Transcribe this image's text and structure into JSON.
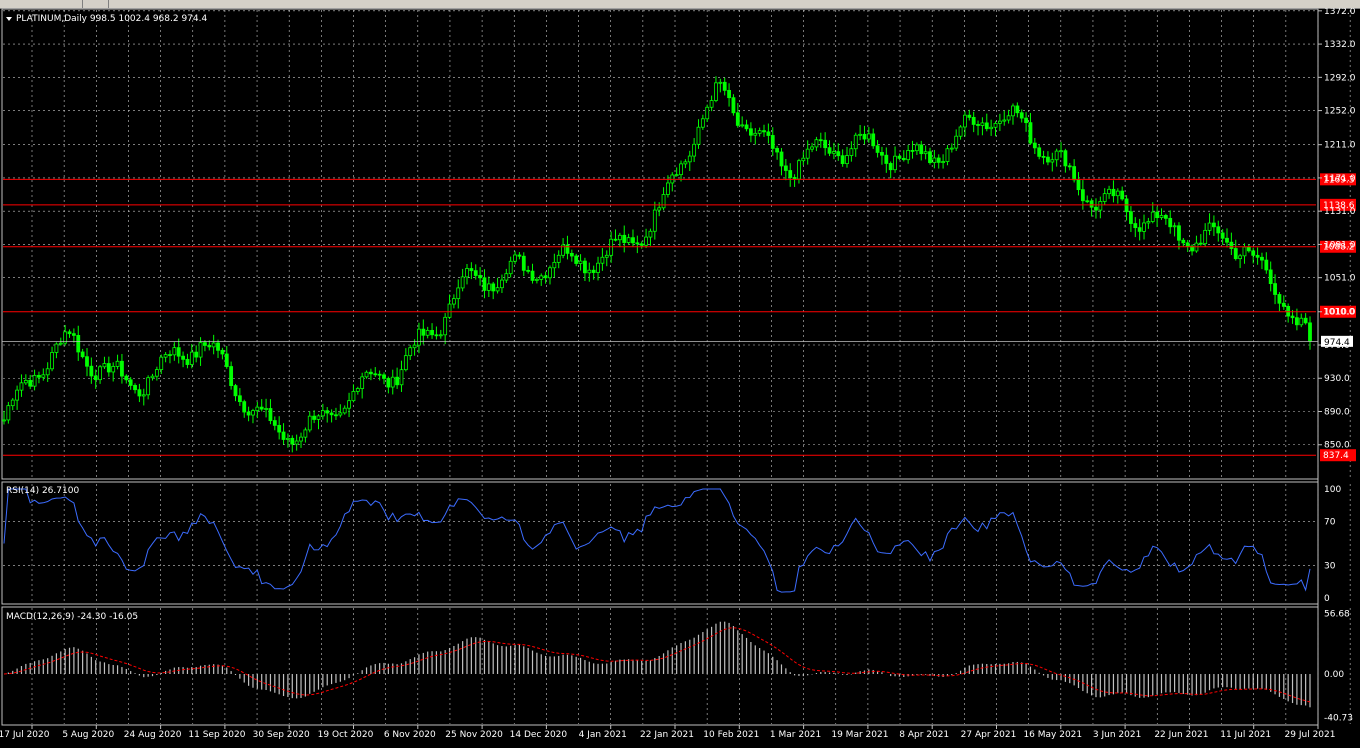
{
  "main_pane": {
    "symbol": "PLATINUM",
    "timeframe": "Daily",
    "ohlc": "998.5 1002.4 968.2 974.4",
    "title": "PLATINUM,Daily  998.5 1002.4 968.2 974.4",
    "current_price": "974.4",
    "y_ticks": [
      "1372.0",
      "1332.0",
      "1292.0",
      "1252.0",
      "1211.0",
      "1171.0",
      "1131.0",
      "1091.0",
      "1051.0",
      "1010.0",
      "970.0",
      "930.0",
      "890.0",
      "850.0"
    ],
    "y_range": [
      810,
      1373
    ]
  },
  "levels": [
    {
      "value": 1169.3,
      "label": "1169.3"
    },
    {
      "value": 1138.6,
      "label": "1138.6"
    },
    {
      "value": 1088.2,
      "label": "1088.2"
    },
    {
      "value": 1010.0,
      "label": "1010.0"
    },
    {
      "value": 837.4,
      "label": "837.4"
    }
  ],
  "rsi_pane": {
    "title": "RSI(14) 26.7100",
    "y_ticks": [
      "100",
      "70",
      "30",
      "0"
    ],
    "current": 26.71
  },
  "macd_pane": {
    "title": "MACD(12,26,9) -24.30 -16.05",
    "y_ticks": [
      "56.68",
      "0.00",
      "-40.73"
    ],
    "range": [
      -45,
      60
    ]
  },
  "x_axis": {
    "dates": [
      "17 Jul 2020",
      "5 Aug 2020",
      "24 Aug 2020",
      "11 Sep 2020",
      "30 Sep 2020",
      "19 Oct 2020",
      "6 Nov 2020",
      "25 Nov 2020",
      "14 Dec 2020",
      "4 Jan 2021",
      "22 Jan 2021",
      "10 Feb 2021",
      "1 Mar 2021",
      "19 Mar 2021",
      "8 Apr 2021",
      "27 Apr 2021",
      "16 May 2021",
      "3 Jun 2021",
      "22 Jun 2021",
      "11 Jul 2021",
      "29 Jul 2021"
    ]
  },
  "colors": {
    "background": "#000000",
    "grid": "#c8c8c8",
    "candle": "#00ff00",
    "level_line": "#ff0000",
    "level_label_bg": "#ff0000",
    "rsi_line": "#3c6cff",
    "macd_hist": "#c0c0c0",
    "macd_signal": "#ff0000",
    "axis_text": "#ffffff"
  },
  "chart_data": {
    "type": "line",
    "title": "PLATINUM,Daily",
    "x": [
      "17 Jul 2020",
      "5 Aug 2020",
      "24 Aug 2020",
      "11 Sep 2020",
      "30 Sep 2020",
      "19 Oct 2020",
      "6 Nov 2020",
      "25 Nov 2020",
      "14 Dec 2020",
      "4 Jan 2021",
      "22 Jan 2021",
      "10 Feb 2021",
      "1 Mar 2021",
      "19 Mar 2021",
      "8 Apr 2021",
      "27 Apr 2021",
      "16 May 2021",
      "3 Jun 2021",
      "22 Jun 2021",
      "11 Jul 2021",
      "29 Jul 2021"
    ],
    "series": [
      {
        "name": "PLATINUM",
        "values": [
          880,
          965,
          940,
          955,
          885,
          880,
          930,
          1060,
          1040,
          1090,
          1120,
          1270,
          1200,
          1190,
          1210,
          1240,
          1200,
          1150,
          1080,
          1110,
          974.4
        ]
      }
    ],
    "ylim": [
      810,
      1373
    ]
  }
}
